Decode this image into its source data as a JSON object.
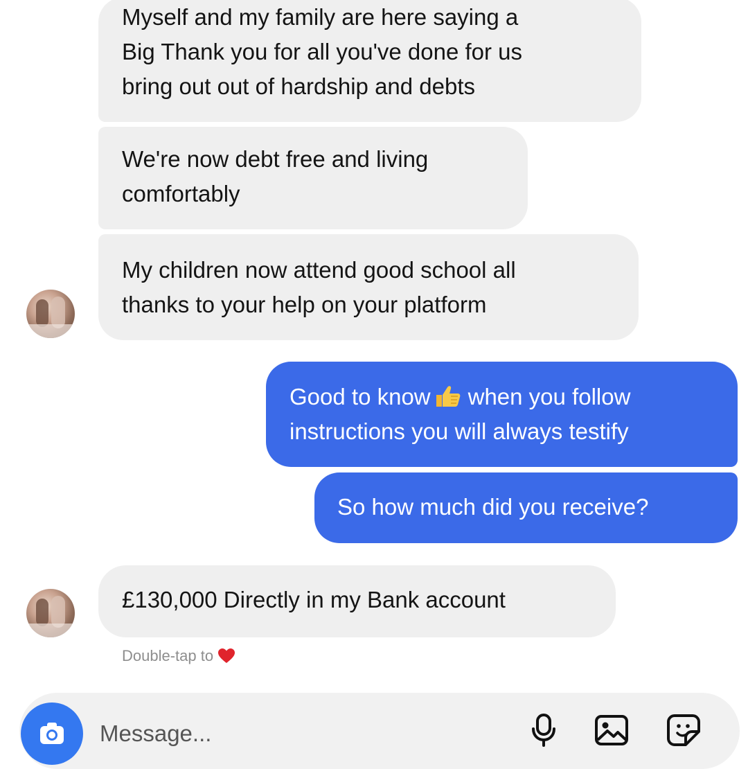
{
  "conversation": {
    "messages": [
      {
        "sender": "contact",
        "lines": [
          "Myself and my family are here saying a",
          "Big Thank you for all you've done for us",
          "bring out out of hardship and debts"
        ]
      },
      {
        "sender": "contact",
        "lines": [
          "We're now debt free and living",
          "comfortably"
        ]
      },
      {
        "sender": "contact",
        "lines": [
          "My children now attend good school all",
          "thanks to your help on your platform"
        ]
      },
      {
        "sender": "me",
        "lines": [
          "Good to know",
          "when you follow",
          "instructions you will always testify"
        ],
        "emoji": "thumbs-up"
      },
      {
        "sender": "me",
        "lines": [
          "So how much did you receive?"
        ]
      },
      {
        "sender": "contact",
        "lines": [
          "£130,000 Directly in my Bank account"
        ]
      }
    ],
    "double_tap_hint": "Double-tap to",
    "hint_icon": "heart-icon"
  },
  "composer": {
    "placeholder": "Message...",
    "icons": [
      "camera-icon",
      "microphone-icon",
      "gallery-icon",
      "sticker-icon"
    ]
  },
  "colors": {
    "incoming_bubble": "#efefef",
    "outgoing_bubble": "#3b6ae8",
    "camera_button": "#3478f0",
    "heart": "#e0242c"
  }
}
